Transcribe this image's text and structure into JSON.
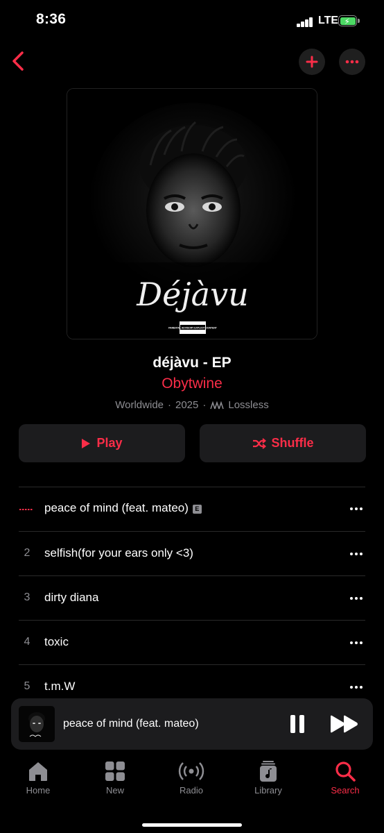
{
  "status_bar": {
    "time": "8:36",
    "network": "LTE"
  },
  "album": {
    "title": "déjàvu - EP",
    "artist": "Obytwine",
    "meta": {
      "region": "Worldwide",
      "year": "2025",
      "quality": "Lossless",
      "separator": "·"
    },
    "cover_script_text": "Déjàvu",
    "advisory_text": "PARENTAL ADVISORY EXPLICIT CONTENT"
  },
  "actions": {
    "play_label": "Play",
    "shuffle_label": "Shuffle"
  },
  "tracks": [
    {
      "number": "",
      "title": "peace of mind (feat. mateo)",
      "explicit": true,
      "playing": true
    },
    {
      "number": "2",
      "title": "selfish(for your ears only <3)"
    },
    {
      "number": "3",
      "title": "dirty diana"
    },
    {
      "number": "4",
      "title": "toxic"
    },
    {
      "number": "5",
      "title": "t.m.W"
    }
  ],
  "explicit_badge": "E",
  "now_playing": {
    "title": "peace of mind (feat. mateo)"
  },
  "tab_bar": {
    "home": "Home",
    "new": "New",
    "radio": "Radio",
    "library": "Library",
    "search": "Search",
    "active": "search"
  },
  "colors": {
    "accent": "#fa2d48",
    "background": "#000000",
    "surface": "#1c1c1e",
    "secondary_text": "#8e8e93"
  }
}
